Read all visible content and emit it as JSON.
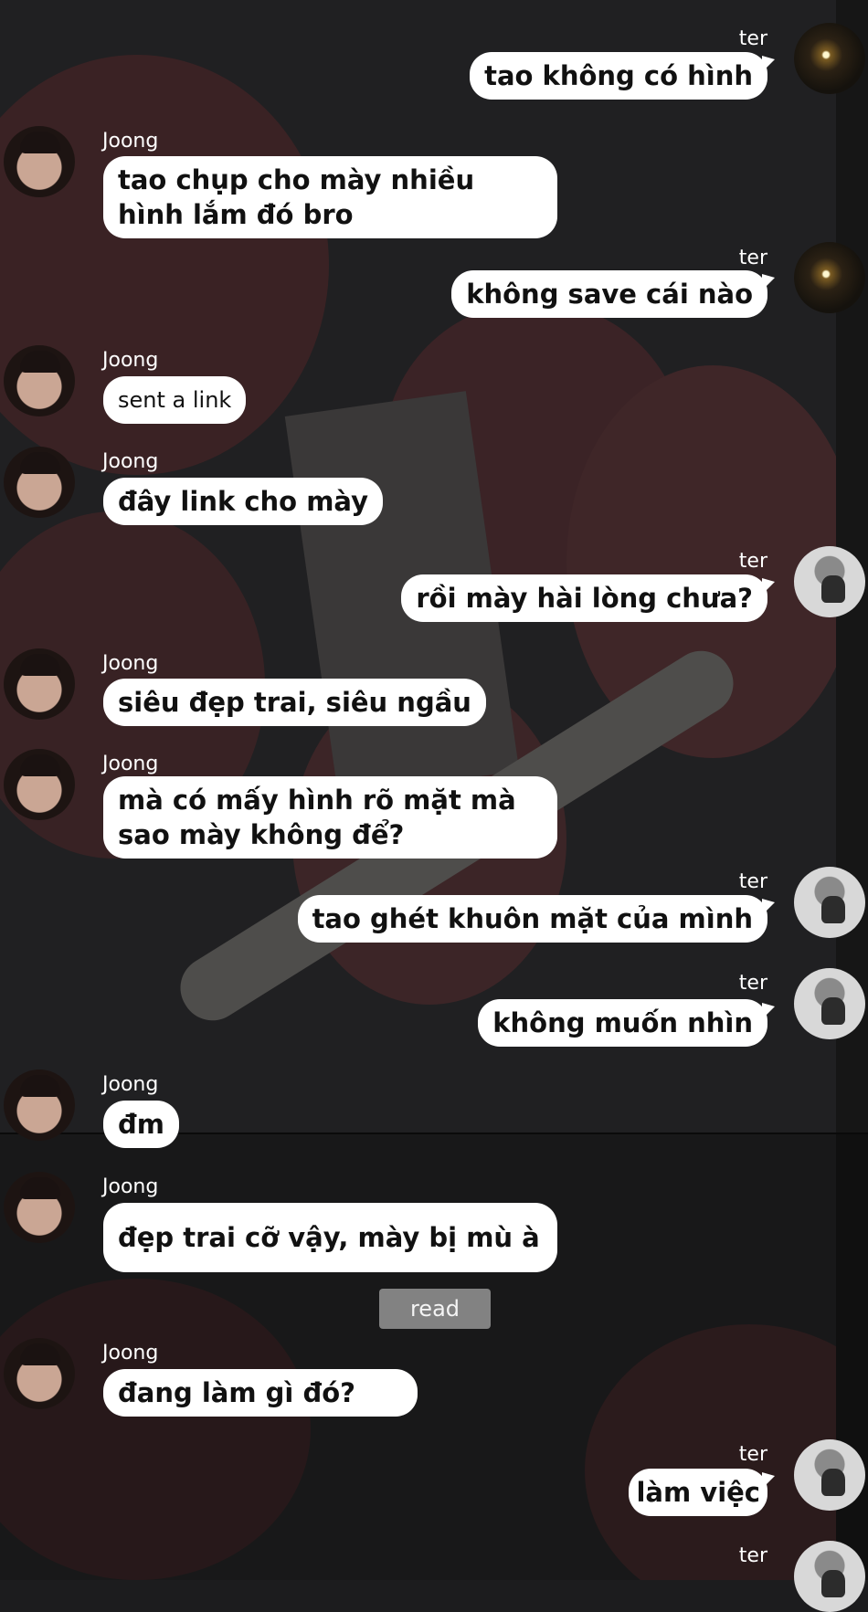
{
  "contacts": {
    "joong": "Joong",
    "ter": "ter"
  },
  "messages": [
    {
      "text": "tao không có hình"
    },
    {
      "text": "tao chụp cho mày nhiều hình lắm đó bro"
    },
    {
      "text": "không save cái nào"
    },
    {
      "text": "sent a link"
    },
    {
      "text": "đây link cho mày"
    },
    {
      "text": "rồi mày hài lòng chưa?"
    },
    {
      "text": "siêu đẹp trai, siêu ngầu"
    },
    {
      "text": "mà có mấy hình rõ mặt mà sao mày không để?"
    },
    {
      "text": "tao ghét khuôn mặt của mình"
    },
    {
      "text": "không muốn nhìn"
    },
    {
      "text": "đm"
    },
    {
      "text": "đẹp trai cỡ vậy, mày bị mù à"
    },
    {
      "text": "đang làm gì đó?"
    },
    {
      "text": "làm việc"
    }
  ],
  "status": {
    "read_label": "read"
  },
  "colors": {
    "bubble": "#ffffff",
    "text": "#111111",
    "read_badge": "#828282"
  },
  "icons": {
    "joong_avatar": "avatar-photo",
    "ter_avatar": "avatar-photo"
  }
}
